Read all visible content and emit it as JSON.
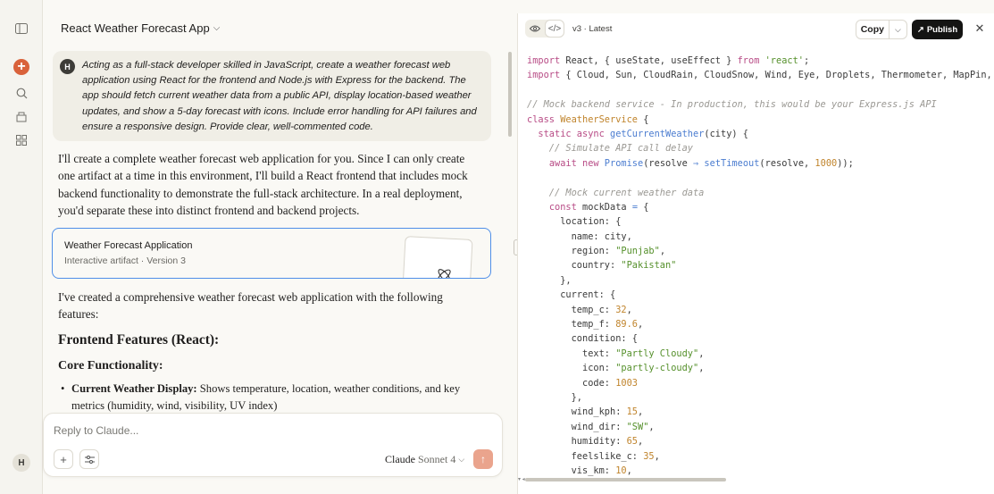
{
  "rail": {
    "avatar": "H"
  },
  "chat": {
    "title": "React Weather Forecast App",
    "user_avatar": "H",
    "user_message": "Acting as a full-stack developer skilled in JavaScript, create a weather forecast web application using React for the frontend and Node.js with Express for the backend. The app should fetch current weather data from a public API, display location-based weather updates, and show a 5-day forecast with icons. Include error handling for API failures and ensure a responsive design. Provide clear, well-commented code.",
    "reply_1": "I'll create a complete weather forecast web application for you. Since I can only create one artifact at a time in this environment, I'll build a React frontend that includes mock backend functionality to demonstrate the full-stack architecture. In a real deployment, you'd separate these into distinct frontend and backend projects.",
    "artifact": {
      "title": "Weather Forecast Application",
      "subtitle": "Interactive artifact · Version 3"
    },
    "reply_2": "I've created a comprehensive weather forecast web application with the following features:",
    "heading_1": "Frontend Features (React):",
    "heading_2": "Core Functionality:",
    "bullet_1_bold": "Current Weather Display:",
    "bullet_1_text": " Shows temperature, location, weather conditions, and key metrics (humidity, wind, visibility, UV index)"
  },
  "composer": {
    "placeholder": "Reply to Claude...",
    "model_name": "Claude",
    "model_version": "Sonnet 4"
  },
  "code_pane": {
    "version_label": "v3 · Latest",
    "copy_label": "Copy",
    "publish_label": "Publish",
    "lines": [
      [
        [
          "kw",
          "import"
        ],
        [
          "p",
          " React, { useState, useEffect } "
        ],
        [
          "kw",
          "from"
        ],
        [
          "str",
          " 'react'"
        ],
        [
          "p",
          ";"
        ]
      ],
      [
        [
          "kw",
          "import"
        ],
        [
          "p",
          " { Cloud, Sun, CloudRain, CloudSnow, Wind, Eye, Droplets, Thermometer, MapPin,"
        ]
      ],
      [],
      [
        [
          "cm",
          "// Mock backend service - In production, this would be your Express.js API"
        ]
      ],
      [
        [
          "kw",
          "class"
        ],
        [
          "cls",
          " WeatherService"
        ],
        [
          "p",
          " {"
        ]
      ],
      [
        [
          "p",
          "  "
        ],
        [
          "kw",
          "static async"
        ],
        [
          "fn",
          " getCurrentWeather"
        ],
        [
          "p",
          "(city) {"
        ]
      ],
      [
        [
          "cm",
          "    // Simulate API call delay"
        ]
      ],
      [
        [
          "p",
          "    "
        ],
        [
          "kw",
          "await new"
        ],
        [
          "fn",
          " Promise"
        ],
        [
          "p",
          "(resolve "
        ],
        [
          "op",
          "⇒"
        ],
        [
          "fn",
          " setTimeout"
        ],
        [
          "p",
          "(resolve, "
        ],
        [
          "num",
          "1000"
        ],
        [
          "p",
          "));"
        ]
      ],
      [],
      [
        [
          "cm",
          "    // Mock current weather data"
        ]
      ],
      [
        [
          "p",
          "    "
        ],
        [
          "kw",
          "const"
        ],
        [
          "p",
          " mockData "
        ],
        [
          "op",
          "="
        ],
        [
          "p",
          " {"
        ]
      ],
      [
        [
          "p",
          "      location: {"
        ]
      ],
      [
        [
          "p",
          "        name: city,"
        ]
      ],
      [
        [
          "p",
          "        region: "
        ],
        [
          "str",
          "\"Punjab\""
        ],
        [
          "p",
          ","
        ]
      ],
      [
        [
          "p",
          "        country: "
        ],
        [
          "str",
          "\"Pakistan\""
        ]
      ],
      [
        [
          "p",
          "      },"
        ]
      ],
      [
        [
          "p",
          "      current: {"
        ]
      ],
      [
        [
          "p",
          "        temp_c: "
        ],
        [
          "num",
          "32"
        ],
        [
          "p",
          ","
        ]
      ],
      [
        [
          "p",
          "        temp_f: "
        ],
        [
          "num",
          "89.6"
        ],
        [
          "p",
          ","
        ]
      ],
      [
        [
          "p",
          "        condition: {"
        ]
      ],
      [
        [
          "p",
          "          text: "
        ],
        [
          "str",
          "\"Partly Cloudy\""
        ],
        [
          "p",
          ","
        ]
      ],
      [
        [
          "p",
          "          icon: "
        ],
        [
          "str",
          "\"partly-cloudy\""
        ],
        [
          "p",
          ","
        ]
      ],
      [
        [
          "p",
          "          code: "
        ],
        [
          "num",
          "1003"
        ]
      ],
      [
        [
          "p",
          "        },"
        ]
      ],
      [
        [
          "p",
          "        wind_kph: "
        ],
        [
          "num",
          "15"
        ],
        [
          "p",
          ","
        ]
      ],
      [
        [
          "p",
          "        wind_dir: "
        ],
        [
          "str",
          "\"SW\""
        ],
        [
          "p",
          ","
        ]
      ],
      [
        [
          "p",
          "        humidity: "
        ],
        [
          "num",
          "65"
        ],
        [
          "p",
          ","
        ]
      ],
      [
        [
          "p",
          "        feelslike_c: "
        ],
        [
          "num",
          "35"
        ],
        [
          "p",
          ","
        ]
      ],
      [
        [
          "p",
          "        vis_km: "
        ],
        [
          "num",
          "10"
        ],
        [
          "p",
          ","
        ]
      ]
    ]
  }
}
